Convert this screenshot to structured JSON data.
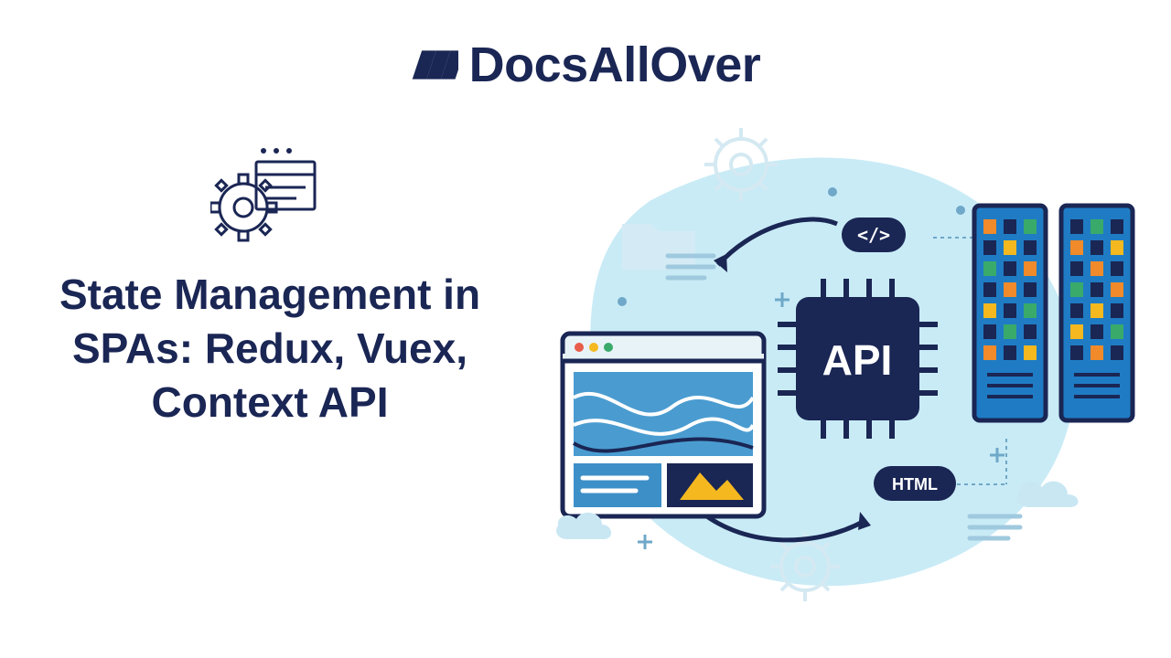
{
  "brand": {
    "name": "DocsAllOver"
  },
  "title": "State Management in SPAs: Redux, Vuex, Context API",
  "illustration": {
    "api_label": "API",
    "code_badge": "</>",
    "html_badge": "HTML"
  },
  "colors": {
    "navy": "#1a2654",
    "light_blue": "#b9e4f3",
    "mid_blue": "#3d8fc7",
    "bright_blue": "#1f7cc4",
    "yellow": "#f5b81f",
    "orange": "#f08a2a",
    "green": "#3aaa6b",
    "white": "#ffffff"
  }
}
